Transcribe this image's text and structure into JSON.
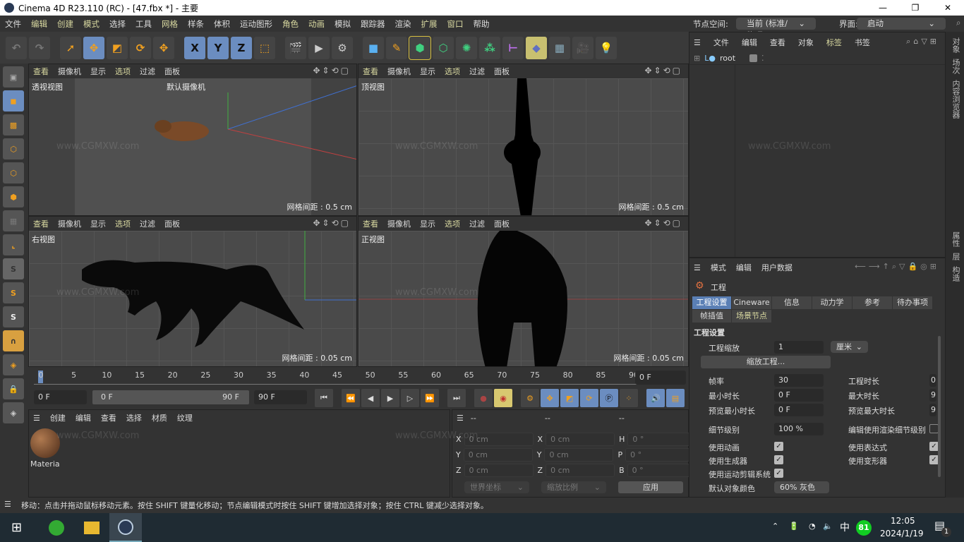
{
  "window": {
    "title": "Cinema 4D R23.110 (RC) - [47.fbx *] - 主要",
    "minimize": "—",
    "maximize": "❐",
    "close": "✕"
  },
  "menu": [
    "文件",
    "编辑",
    "创建",
    "模式",
    "选择",
    "工具",
    "网格",
    "样条",
    "体积",
    "运动图形",
    "角色",
    "动画",
    "模拟",
    "跟踪器",
    "渲染",
    "扩展",
    "窗口",
    "帮助"
  ],
  "nodespace": {
    "label": "节点空间:",
    "value": "当前 (标准/物理)"
  },
  "layout": {
    "label": "界面:",
    "value": "启动"
  },
  "toolbar": {
    "axis_x": "X",
    "axis_y": "Y",
    "axis_z": "Z"
  },
  "viewports": [
    {
      "menu": [
        "查看",
        "摄像机",
        "显示",
        "选项",
        "过滤",
        "面板"
      ],
      "name": "透视视图",
      "camera": "默认摄像机",
      "grid": "网格间距 : 0.5 cm"
    },
    {
      "menu": [
        "查看",
        "摄像机",
        "显示",
        "选项",
        "过滤",
        "面板"
      ],
      "name": "顶视图",
      "grid": "网格间距 : 0.5 cm"
    },
    {
      "menu": [
        "查看",
        "摄像机",
        "显示",
        "选项",
        "过滤",
        "面板"
      ],
      "name": "右视图",
      "grid": "网格间距 : 0.05 cm"
    },
    {
      "menu": [
        "查看",
        "摄像机",
        "显示",
        "选项",
        "过滤",
        "面板"
      ],
      "name": "正视图",
      "grid": "网格间距 : 0.05 cm"
    }
  ],
  "timeline": {
    "ticks": [
      "0",
      "5",
      "10",
      "15",
      "20",
      "25",
      "30",
      "35",
      "40",
      "45",
      "50",
      "55",
      "60",
      "65",
      "70",
      "75",
      "80",
      "85",
      "90"
    ],
    "current_frame": "0 F",
    "start": "0 F",
    "range_start": "0 F",
    "range_end": "90 F",
    "end": "90 F"
  },
  "materials": {
    "menu": [
      "创建",
      "编辑",
      "查看",
      "选择",
      "材质",
      "纹理"
    ],
    "items": [
      {
        "name": "Materia"
      }
    ]
  },
  "coords": {
    "headers": [
      "--",
      "--",
      "--"
    ],
    "rows": [
      {
        "l1": "X",
        "v1": "0 cm",
        "l2": "X",
        "v2": "0 cm",
        "l3": "H",
        "v3": "0 °"
      },
      {
        "l1": "Y",
        "v1": "0 cm",
        "l2": "Y",
        "v2": "0 cm",
        "l3": "P",
        "v3": "0 °"
      },
      {
        "l1": "Z",
        "v1": "0 cm",
        "l2": "Z",
        "v2": "0 cm",
        "l3": "B",
        "v3": "0 °"
      }
    ],
    "mode1": "世界坐标",
    "mode2": "缩放比例",
    "apply": "应用"
  },
  "objects": {
    "menu": [
      "文件",
      "编辑",
      "查看",
      "对象",
      "标签",
      "书签"
    ],
    "root": "root"
  },
  "attributes": {
    "menu": [
      "模式",
      "编辑",
      "用户数据"
    ],
    "title": "工程",
    "tabs": [
      "工程设置",
      "Cineware",
      "信息",
      "动力学",
      "参考",
      "待办事项",
      "帧插值",
      "场景节点"
    ],
    "section": "工程设置",
    "scale_label": "工程缩放",
    "scale_value": "1",
    "unit": "厘米",
    "scale_button": "缩放工程...",
    "fps_label": "帧率",
    "fps": "30",
    "project_time_label": "工程时长",
    "project_time": "0",
    "min_time_label": "最小时长",
    "min_time": "0 F",
    "max_time_label": "最大时长",
    "max_time": "9",
    "prev_min_label": "预览最小时长",
    "prev_min": "0 F",
    "prev_max_label": "预览最大时长",
    "prev_max": "9",
    "lod_label": "细节级别",
    "lod": "100 %",
    "render_lod_label": "编辑使用渲染细节级别",
    "use_anim": "使用动画",
    "use_expr": "使用表达式",
    "use_gen": "使用生成器",
    "use_deform": "使用变形器",
    "use_motion": "使用运动剪辑系统",
    "default_color_label": "默认对象颜色",
    "default_color": "60% 灰色"
  },
  "side_tabs": [
    "对象",
    "场次",
    "内容浏览器",
    "属性",
    "层",
    "构造"
  ],
  "status": "移动：点击并拖动鼠标移动元素。按住 SHIFT 键量化移动；节点编辑模式时按住 SHIFT 键增加选择对象；按住 CTRL 键减少选择对象。",
  "taskbar": {
    "time": "12:05",
    "date": "2024/1/19",
    "ime": "中",
    "badge": "81",
    "notif": "1"
  },
  "watermark": "www.CGMXW.com",
  "colors": {
    "accent": "#5a7fb5",
    "menu_highlight": "#d8d8a0",
    "tool_orange": "#f0a020"
  }
}
